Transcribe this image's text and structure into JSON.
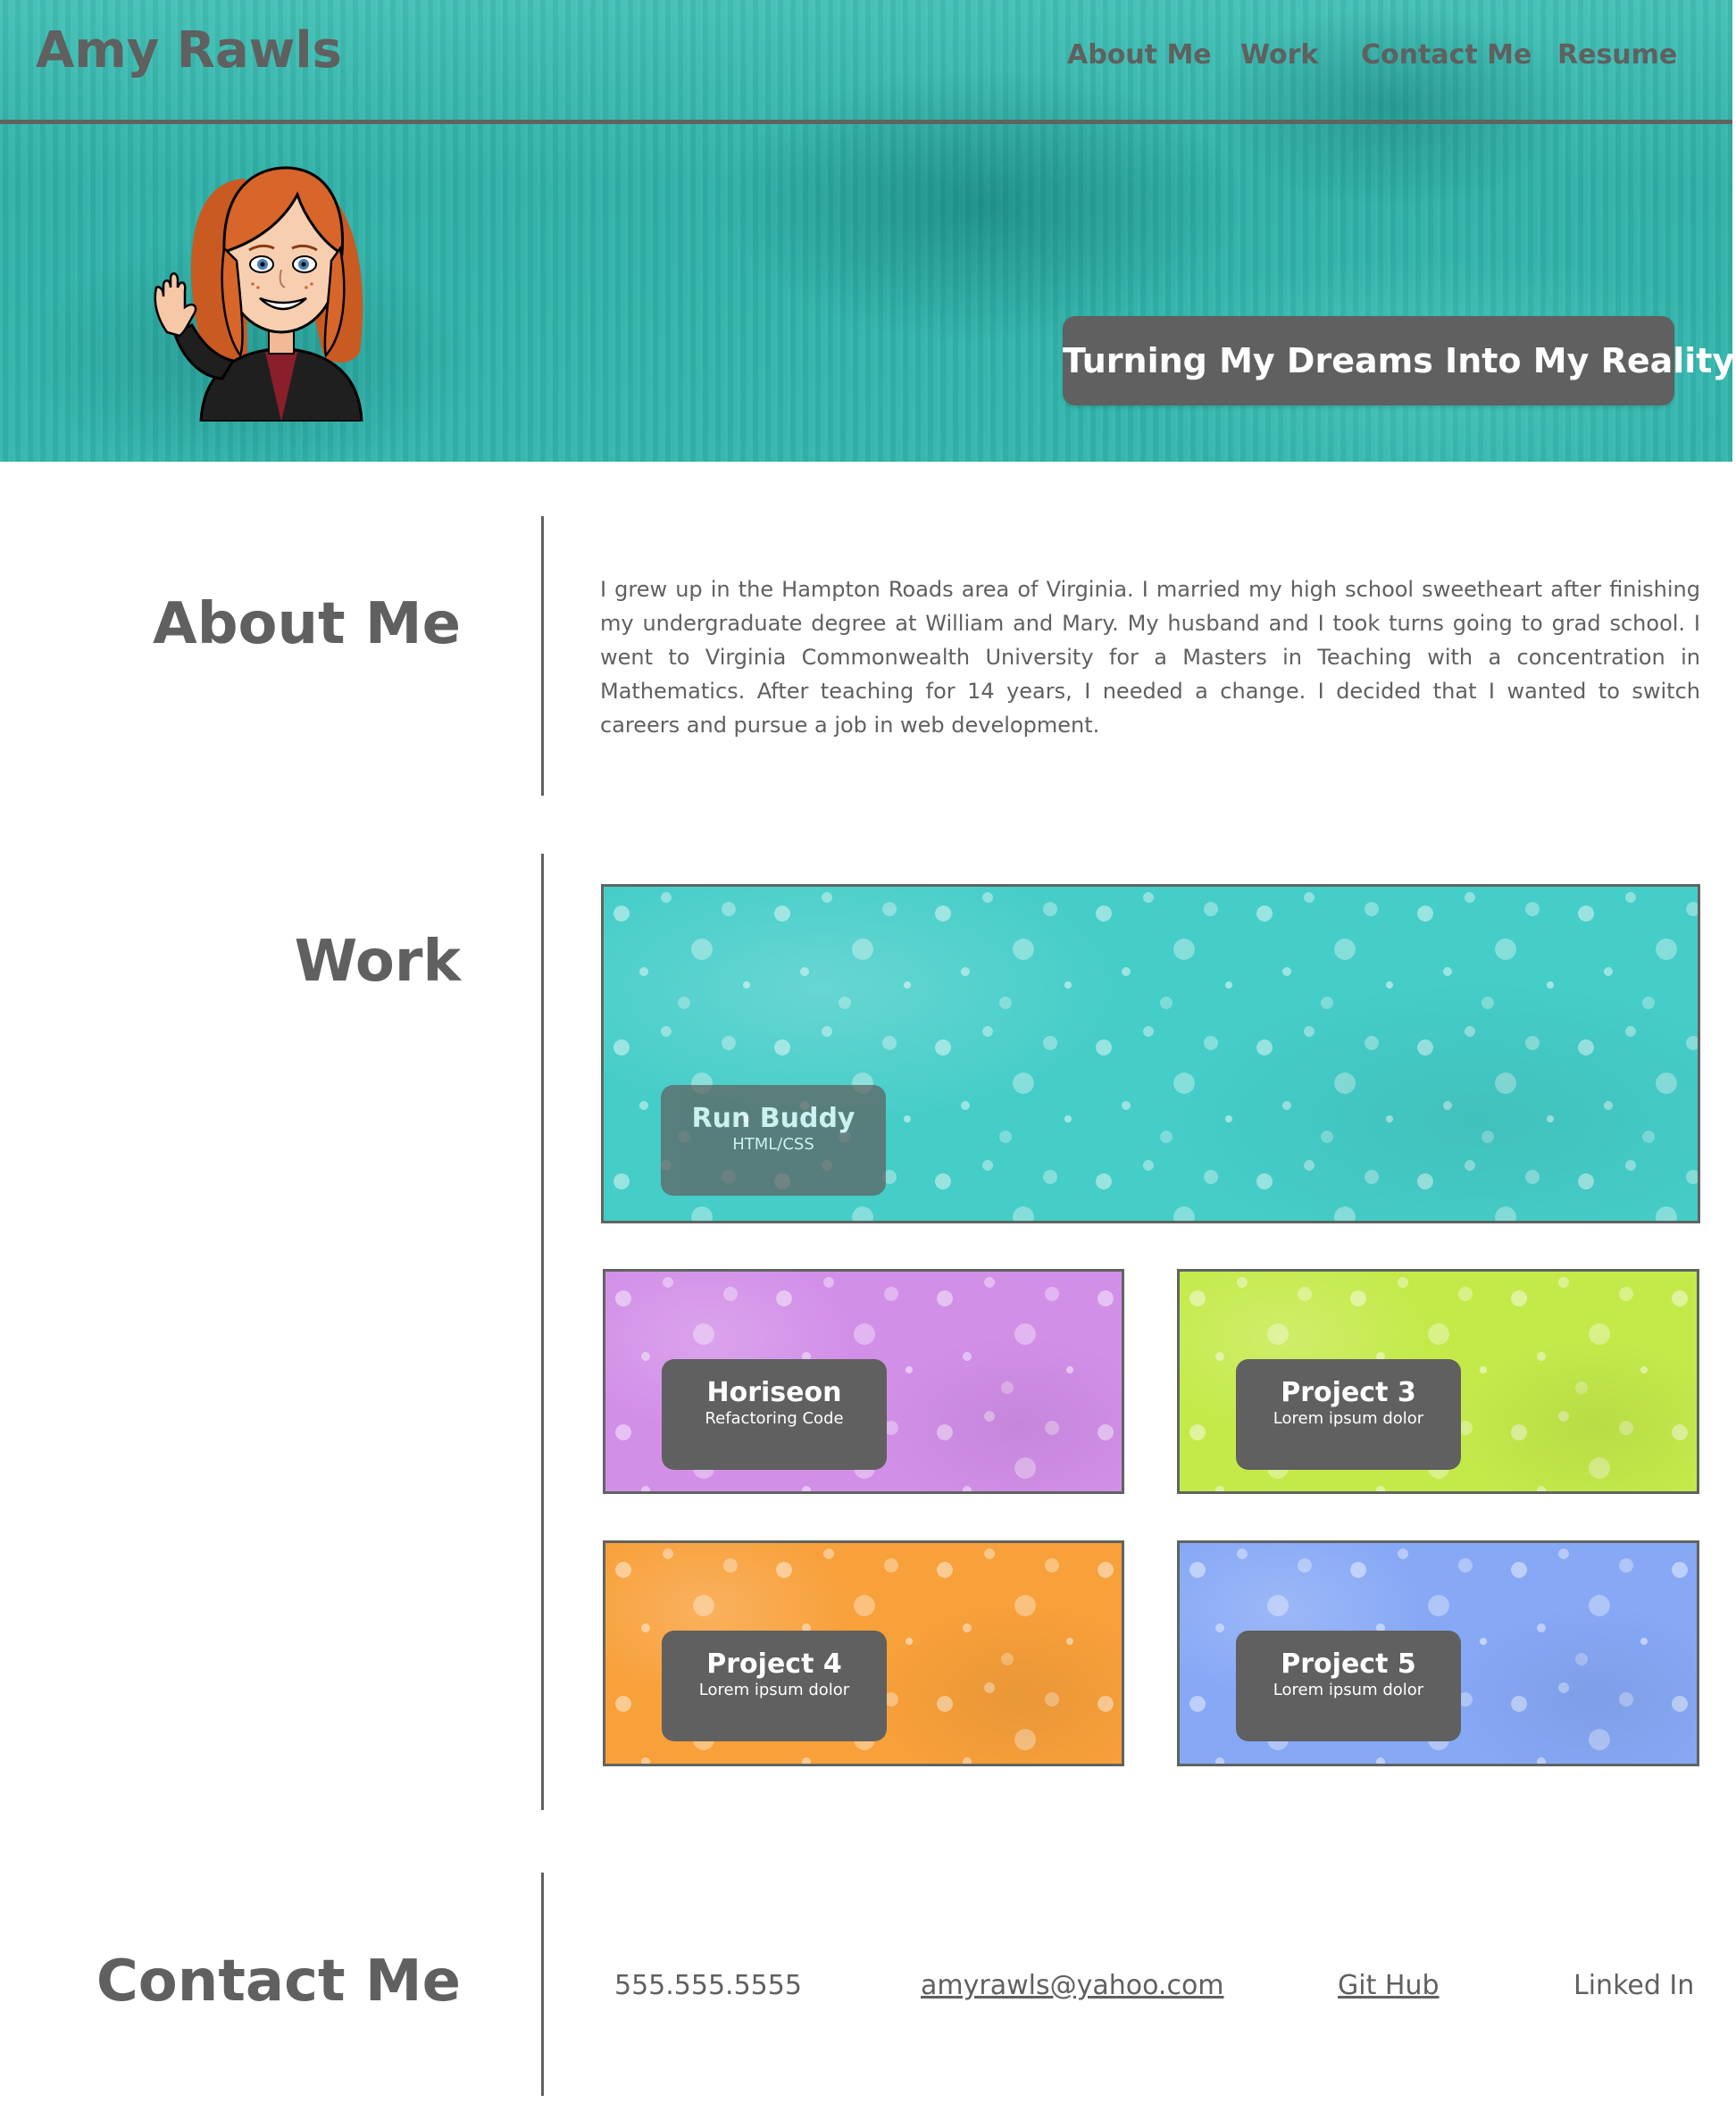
{
  "header": {
    "site_name": "Amy Rawls",
    "nav": [
      "About Me",
      "Work",
      "Contact Me",
      "Resume"
    ]
  },
  "hero": {
    "tagline": "Turning My Dreams Into My Reality",
    "avatar_icon": "waving-avatar-icon"
  },
  "about": {
    "heading": "About Me",
    "text": "I grew up in the Hampton Roads area of Virginia. I married my high school sweetheart after finishing my undergraduate degree at William and Mary. My husband and I took turns going to grad school. I went to Virginia Commonwealth University for a Masters in Teaching with a concentration in Mathematics. After teaching for 14 years, I needed a change. I decided that I wanted to switch careers and pursue a job in web development."
  },
  "work": {
    "heading": "Work",
    "projects": [
      {
        "title": "Run Buddy",
        "subtitle": "HTML/CSS",
        "color": "#45cdc8"
      },
      {
        "title": "Horiseon",
        "subtitle": "Refactoring Code",
        "color": "#d28fe8"
      },
      {
        "title": "Project 3",
        "subtitle": "Lorem ipsum dolor",
        "color": "#c4ea4a"
      },
      {
        "title": "Project 4",
        "subtitle": "Lorem ipsum dolor",
        "color": "#f8a03a"
      },
      {
        "title": "Project 5",
        "subtitle": "Lorem ipsum dolor",
        "color": "#86a8f5"
      }
    ]
  },
  "contact": {
    "heading": "Contact Me",
    "phone": "555.555.5555",
    "email": "amyrawls@yahoo.com",
    "github": "Git Hub",
    "linkedin": "Linked In"
  },
  "colors": {
    "accent_teal": "#35b8ae",
    "text_gray": "#5f605f",
    "label_bg": "#5f605f"
  }
}
